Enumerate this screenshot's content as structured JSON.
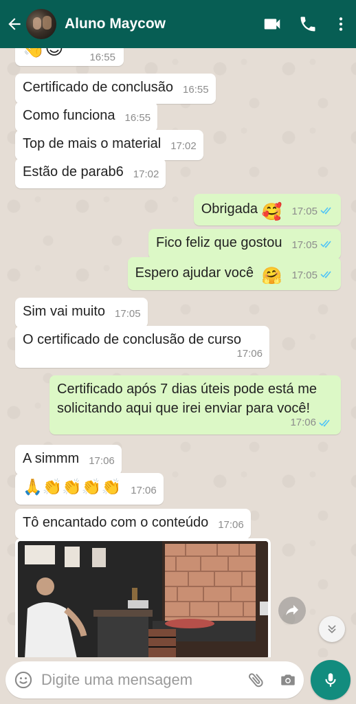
{
  "header": {
    "contact_name": "Aluno Maycow",
    "background": "#075e54",
    "icons": [
      "back-arrow-icon",
      "video-call-icon",
      "phone-icon",
      "more-vert-icon"
    ]
  },
  "messages": [
    {
      "dir": "in",
      "text": "👋😍",
      "time": "16:55"
    },
    {
      "dir": "in",
      "text": "Certificado de conclusão",
      "time": "16:55"
    },
    {
      "dir": "in",
      "text": "Como funciona",
      "time": "16:55"
    },
    {
      "dir": "in",
      "text": "Top de mais o material",
      "time": "17:02"
    },
    {
      "dir": "in",
      "text": "Estão de parab6",
      "time": "17:02"
    },
    {
      "dir": "out",
      "text": "Obrigada",
      "emoji": "🥰",
      "time": "17:05",
      "status": "read"
    },
    {
      "dir": "out",
      "text": "Fico feliz que gostou",
      "time": "17:05",
      "status": "read"
    },
    {
      "dir": "out",
      "text": "Espero ajudar você",
      "emoji": "🤗",
      "time": "17:05",
      "status": "read"
    },
    {
      "dir": "in",
      "text": "Sim vai muito",
      "time": "17:05"
    },
    {
      "dir": "in",
      "text": "O certificado de conclusão de curso",
      "time": "17:06"
    },
    {
      "dir": "out",
      "text": "Certificado após 7 dias úteis pode está me solicitando aqui que irei enviar para você!",
      "time": "17:06",
      "status": "read"
    },
    {
      "dir": "in",
      "text": "A simmm",
      "time": "17:06"
    },
    {
      "dir": "in",
      "text": "🙏👏👏👏👏",
      "time": "17:06"
    },
    {
      "dir": "in",
      "text": "Tô encantado com o conteúdo",
      "time": "17:06"
    },
    {
      "dir": "in",
      "type": "image",
      "caption": ""
    }
  ],
  "composer": {
    "placeholder": "Digite uma mensagem"
  },
  "colors": {
    "incoming_bubble": "#ffffff",
    "outgoing_bubble": "#dcf8c6",
    "chat_background": "#e5ddd5",
    "read_ticks": "#4fc3f7",
    "mic_button": "#128c7e"
  }
}
